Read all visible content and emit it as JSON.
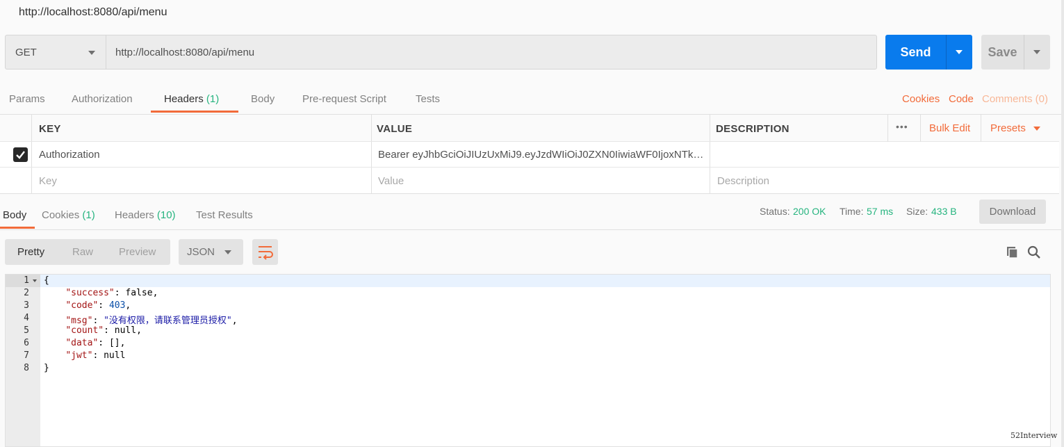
{
  "window": {
    "title": "http://localhost:8080/api/menu"
  },
  "request": {
    "method": "GET",
    "url": "http://localhost:8080/api/menu",
    "send_label": "Send",
    "save_label": "Save"
  },
  "request_tabs": {
    "params": "Params",
    "authorization": "Authorization",
    "headers": "Headers",
    "headers_count": "(1)",
    "body": "Body",
    "prerequest": "Pre-request Script",
    "tests": "Tests",
    "cookies": "Cookies",
    "code": "Code",
    "comments": "Comments (0)"
  },
  "headers_table": {
    "col_key": "KEY",
    "col_value": "VALUE",
    "col_description": "DESCRIPTION",
    "more": "•••",
    "bulk_edit": "Bulk Edit",
    "presets": "Presets",
    "rows": [
      {
        "checked": true,
        "key": "Authorization",
        "value": "Bearer eyJhbGciOiJIUzUxMiJ9.eyJzdWIiOiJ0ZXN0IiwiaWF0IjoxNTk2...",
        "description": ""
      }
    ],
    "placeholder": {
      "key": "Key",
      "value": "Value",
      "description": "Description"
    }
  },
  "response_tabs": {
    "body": "Body",
    "cookies": "Cookies",
    "cookies_count": "(1)",
    "headers": "Headers",
    "headers_count": "(10)",
    "test_results": "Test Results"
  },
  "response_status": {
    "status_label": "Status:",
    "status_value": "200 OK",
    "time_label": "Time:",
    "time_value": "57 ms",
    "size_label": "Size:",
    "size_value": "433 B",
    "download": "Download"
  },
  "view_options": {
    "pretty": "Pretty",
    "raw": "Raw",
    "preview": "Preview",
    "format": "JSON"
  },
  "response_body": {
    "lines": [
      "1",
      "2",
      "3",
      "4",
      "5",
      "6",
      "7",
      "8"
    ],
    "open_brace": "{",
    "close_brace": "}",
    "success_key": "\"success\"",
    "success_val": "false",
    "code_key": "\"code\"",
    "code_val": "403",
    "msg_key": "\"msg\"",
    "msg_val": "\"没有权限，请联系管理员授权\"",
    "count_key": "\"count\"",
    "count_val": "null",
    "data_key": "\"data\"",
    "data_val": "[]",
    "jwt_key": "\"jwt\"",
    "jwt_val": "null"
  },
  "watermark": "52Interview",
  "colors": {
    "accent": "#f26b3a",
    "send": "#097bed",
    "success": "#26b47f"
  }
}
